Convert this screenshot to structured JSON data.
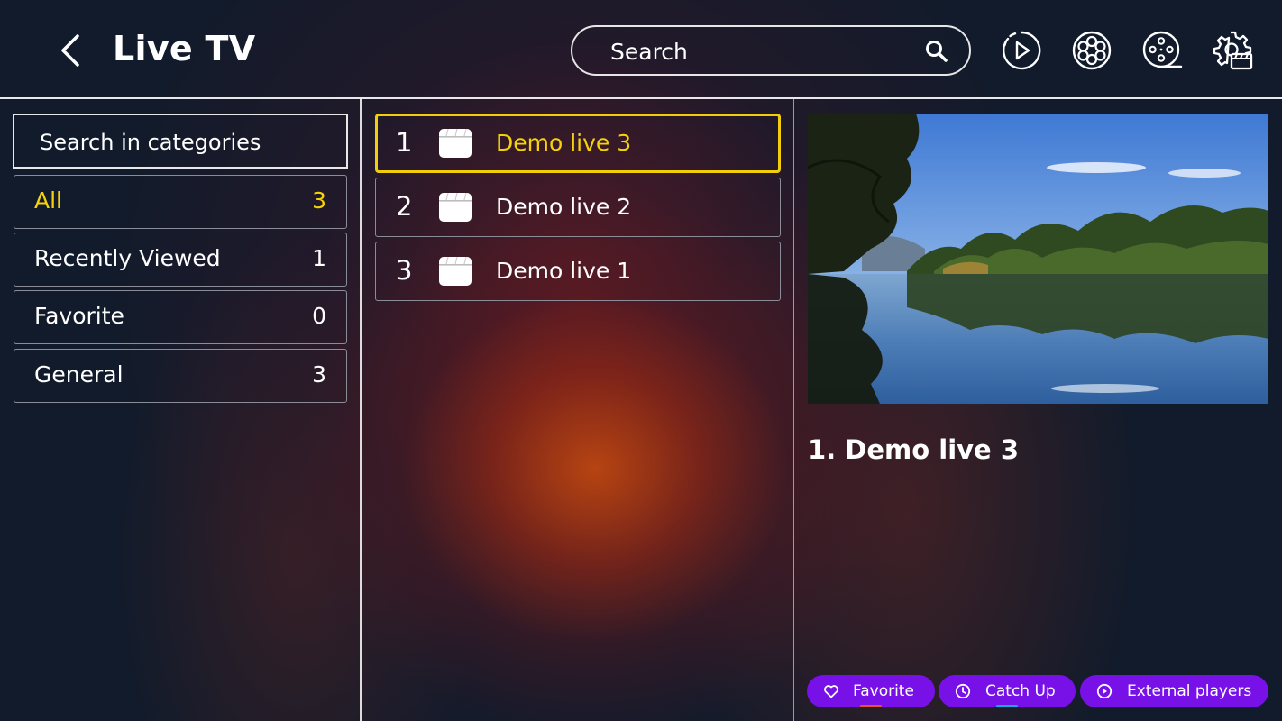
{
  "header": {
    "title": "Live TV",
    "search_placeholder": "Search",
    "icons": [
      "back-icon",
      "search-icon",
      "play-circle-icon",
      "film-reel-icon",
      "movie-reel-icon",
      "settings-icon"
    ]
  },
  "categories": {
    "search_placeholder": "Search in categories",
    "items": [
      {
        "label": "All",
        "count": "3",
        "active": true
      },
      {
        "label": "Recently Viewed",
        "count": "1"
      },
      {
        "label": "Favorite",
        "count": "0"
      },
      {
        "label": "General",
        "count": "3"
      }
    ]
  },
  "channels": [
    {
      "number": "1",
      "name": "Demo live 3",
      "selected": true
    },
    {
      "number": "2",
      "name": "Demo live 2"
    },
    {
      "number": "3",
      "name": "Demo live 1"
    }
  ],
  "preview": {
    "title": "1.  Demo live 3"
  },
  "actions": [
    {
      "label": "Favorite",
      "icon": "heart-icon",
      "underline_color": "#e9532a"
    },
    {
      "label": "Catch Up",
      "icon": "clock-icon",
      "underline_color": "#18a8e0"
    },
    {
      "label": "External players",
      "icon": "play-circle-icon"
    }
  ],
  "colors": {
    "accent_yellow": "#f5d20a",
    "button_purple": "#7711e8",
    "background": "#121b2b"
  }
}
